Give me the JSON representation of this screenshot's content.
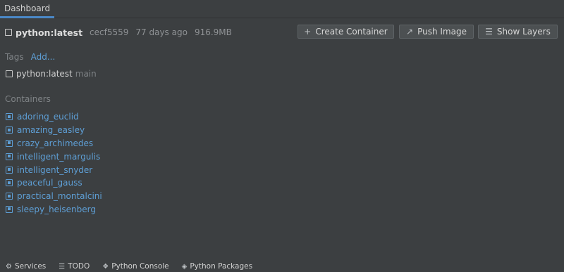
{
  "tab": {
    "label": "Dashboard"
  },
  "image": {
    "name": "python:latest",
    "id": "cecf5559",
    "age": "77 days ago",
    "size": "916.9MB"
  },
  "toolbar": {
    "create_label": "Create Container",
    "push_label": "Push Image",
    "layers_label": "Show Layers",
    "create_icon": "plus-icon",
    "push_icon": "push-arrow-icon",
    "layers_icon": "layers-icon"
  },
  "tags": {
    "label": "Tags",
    "add_label": "Add...",
    "items": [
      {
        "name": "python:latest",
        "branch": "main"
      }
    ]
  },
  "containers": {
    "label": "Containers",
    "items": [
      "adoring_euclid",
      "amazing_easley",
      "crazy_archimedes",
      "intelligent_margulis",
      "intelligent_snyder",
      "peaceful_gauss",
      "practical_montalcini",
      "sleepy_heisenberg"
    ]
  },
  "bottom_bar": {
    "services": "Services",
    "todo": "TODO",
    "python_console": "Python Console",
    "python_packages": "Python Packages"
  },
  "colors": {
    "background": "#3c3f41",
    "accent": "#5e9fd6",
    "tab_underline": "#4a88c7"
  }
}
